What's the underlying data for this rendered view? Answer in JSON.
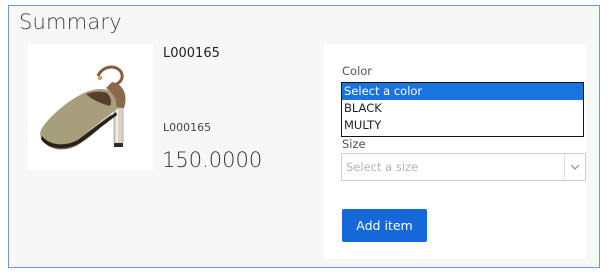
{
  "summary": {
    "title": "Summary",
    "product": {
      "sku": "L000165",
      "sku_secondary": "L000165",
      "price": "150.0000",
      "image": "shoe-image"
    },
    "color": {
      "label": "Color",
      "options": [
        "Select a color",
        "BLACK",
        "MULTY"
      ],
      "selected": "Select a color"
    },
    "size": {
      "label": "Size",
      "placeholder": "Select a size"
    },
    "add_button": "Add item"
  },
  "colors": {
    "accent": "#1568d8",
    "selected_option": "#1874e0",
    "panel_border": "#6d9bd1",
    "panel_bg": "#f7f7f7"
  }
}
